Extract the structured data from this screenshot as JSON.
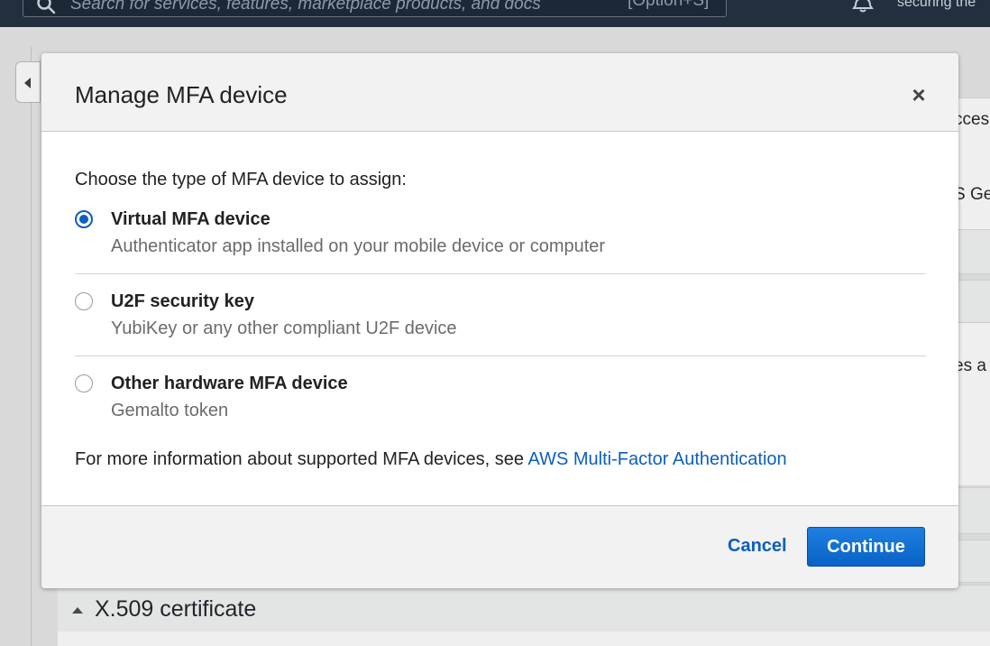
{
  "topnav": {
    "search_placeholder": "Search for services, features, marketplace products, and docs",
    "search_shortcut": "[Option+S]",
    "tagline": "securing the"
  },
  "background": {
    "fragments": [
      "cces",
      "S Ge",
      "es a"
    ],
    "x509_label": "X.509 certificate"
  },
  "modal": {
    "title": "Manage MFA device",
    "close_symbol": "×",
    "prompt": "Choose the type of MFA device to assign:",
    "options": [
      {
        "title": "Virtual MFA device",
        "description": "Authenticator app installed on your mobile device or computer",
        "selected": true
      },
      {
        "title": "U2F security key",
        "description": "YubiKey or any other compliant U2F device",
        "selected": false
      },
      {
        "title": "Other hardware MFA device",
        "description": "Gemalto token",
        "selected": false
      }
    ],
    "info_text": "For more information about supported MFA devices, see ",
    "info_link": "AWS Multi-Factor Authentication",
    "cancel_label": "Cancel",
    "continue_label": "Continue"
  },
  "colors": {
    "nav_bg": "#232f3e",
    "primary_blue": "#0b6bd3",
    "link_blue": "#0b5fbf"
  }
}
